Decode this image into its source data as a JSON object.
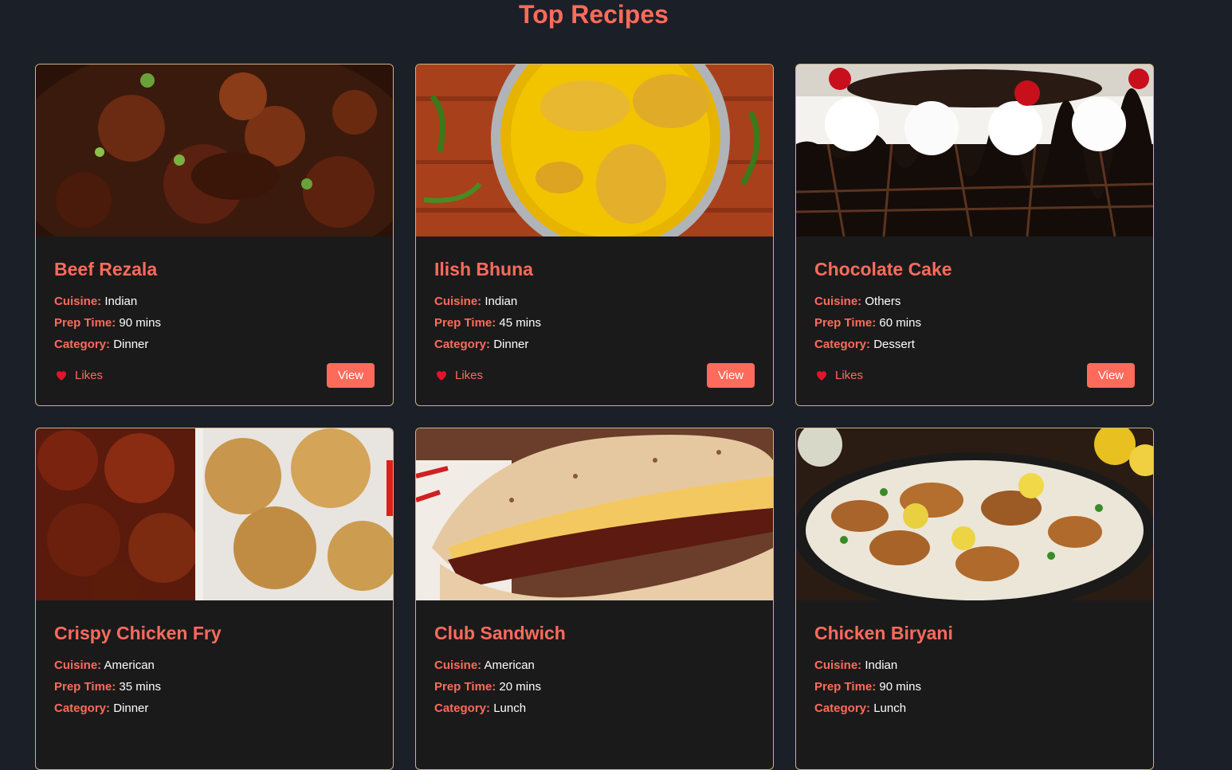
{
  "header": {
    "title": "Top Recipes"
  },
  "labels": {
    "cuisine": "Cuisine:",
    "prep_time": "Prep Time:",
    "category": "Category:",
    "likes": "Likes",
    "view": "View"
  },
  "colors": {
    "accent": "#ff6b5b",
    "background": "#1b1f27",
    "card": "#1a1a1b",
    "card_border": "#c9b48a",
    "heart": "#e0142c"
  },
  "recipes": [
    {
      "title": "Beef Rezala",
      "cuisine": "Indian",
      "prep_time": "90 mins",
      "category": "Dinner",
      "image": "beef-curry-photo"
    },
    {
      "title": "Ilish Bhuna",
      "cuisine": "Indian",
      "prep_time": "45 mins",
      "category": "Dinner",
      "image": "fish-curry-photo"
    },
    {
      "title": "Chocolate Cake",
      "cuisine": "Others",
      "prep_time": "60 mins",
      "category": "Dessert",
      "image": "cake-photo"
    },
    {
      "title": "Crispy Chicken Fry",
      "cuisine": "American",
      "prep_time": "35 mins",
      "category": "Dinner",
      "image": "fried-chicken-photo"
    },
    {
      "title": "Club Sandwich",
      "cuisine": "American",
      "prep_time": "20 mins",
      "category": "Lunch",
      "image": "wrap-sandwich-photo"
    },
    {
      "title": "Chicken Biryani",
      "cuisine": "Indian",
      "prep_time": "90 mins",
      "category": "Lunch",
      "image": "biryani-photo"
    }
  ]
}
